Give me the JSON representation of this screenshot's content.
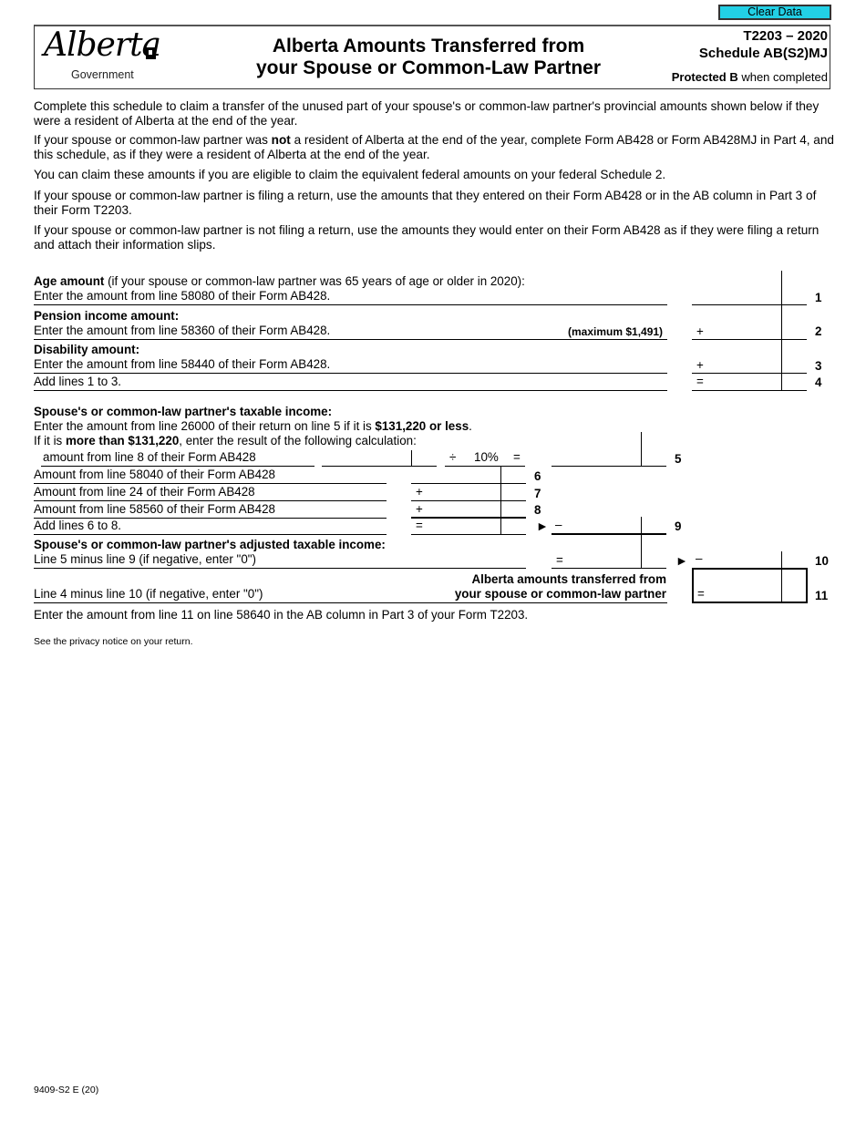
{
  "toolbar": {
    "clear_label": "Clear Data",
    "clear_color": "#22d0e6"
  },
  "header": {
    "logo_text": "Alberta",
    "logo_subtext": "Government",
    "title_line1": "Alberta Amounts Transferred from",
    "title_line2": "your Spouse or Common-Law Partner",
    "form_id": "T2203 – 2020",
    "schedule": "Schedule AB(S2)MJ",
    "protected_bold": "Protected B",
    "protected_rest": " when completed"
  },
  "intro": [
    {
      "parts": [
        {
          "t": "Complete this schedule to claim a transfer of the unused part of your spouse's or common-law partner's provincial amounts shown below if they were a resident of Alberta at the end of the year.",
          "b": false
        }
      ]
    },
    {
      "parts": [
        {
          "t": "If your spouse or common-law partner was ",
          "b": false
        },
        {
          "t": "not",
          "b": true
        },
        {
          "t": " a resident of Alberta at the end of the year, complete Form AB428 or Form AB428MJ in Part 4, and this schedule, as if they were a resident of Alberta at the end of the year.",
          "b": false
        }
      ]
    },
    {
      "parts": [
        {
          "t": "You can claim these amounts if you are eligible to claim the equivalent federal amounts on your federal Schedule 2.",
          "b": false
        }
      ]
    },
    {
      "parts": [
        {
          "t": "If your spouse or common-law partner is filing a return, use the amounts that they entered on their Form AB428 or in the AB column in Part 3 of their Form T2203.",
          "b": false
        }
      ]
    },
    {
      "parts": [
        {
          "t": "If your spouse or common-law partner is not filing a return, use the amounts they would enter on their Form AB428 as if they were filing a return and attach their information slips.",
          "b": false
        }
      ]
    }
  ],
  "lines": {
    "l1": {
      "heading": "Age amount",
      "heading_rest": " (if your spouse or common-law partner was 65 years of age or older in 2020):",
      "text": "Enter the amount from line 58080 of their Form AB428.",
      "num": "1",
      "op": "",
      "value": ""
    },
    "l2": {
      "heading": "Pension income amount:",
      "text": "Enter the amount from line 58360 of their Form AB428.",
      "note": "(maximum $1,491)",
      "num": "2",
      "op": "+",
      "value": ""
    },
    "l3": {
      "heading": "Disability amount:",
      "text": "Enter the amount from line 58440 of their Form AB428.",
      "num": "3",
      "op": "+",
      "value": ""
    },
    "l4": {
      "text": "Add lines 1 to 3.",
      "num": "4",
      "op": "=",
      "value": ""
    },
    "taxable": {
      "heading": "Spouse's or common-law partner's taxable income:",
      "text1_a": "Enter the amount from line 26000 of their return on line 5 if it is ",
      "text1_b": "$131,220 or less",
      "text1_c": ".",
      "text2_a": "If it is ",
      "text2_b": "more than $131,220",
      "text2_c": ", enter the result of the following calculation:"
    },
    "l5": {
      "text": "amount from line 8 of their Form AB428",
      "div_op": "÷",
      "pct": "10%",
      "eq": "=",
      "num": "5",
      "value": ""
    },
    "l6": {
      "text": "Amount from line 58040 of their Form AB428",
      "num": "6",
      "op": "",
      "value": ""
    },
    "l7": {
      "text": "Amount from line 24 of their Form AB428",
      "num": "7",
      "op": "+",
      "value": ""
    },
    "l8": {
      "text": "Amount from line 58560 of their Form AB428",
      "num": "8",
      "op": "+",
      "value": ""
    },
    "l9": {
      "text": "Add lines 6 to 8.",
      "num": "9",
      "op": "=",
      "arrow": "►",
      "minus": "–",
      "value": ""
    },
    "adjusted": {
      "heading": "Spouse's or common-law partner's adjusted taxable income:",
      "text": "Line 5 minus line 9 (if negative, enter \"0\")",
      "op": "=",
      "value": ""
    },
    "l10": {
      "num": "10",
      "arrow": "►",
      "minus": "–",
      "value": ""
    },
    "l11": {
      "text": "Line 4 minus line 10 (if negative, enter \"0\")",
      "label1": "Alberta amounts transferred from",
      "label2": "your spouse or common-law partner",
      "num": "11",
      "op": "=",
      "value": ""
    }
  },
  "footer": {
    "instruction": "Enter the amount from line 11 on line 58640 in the AB column in Part 3 of your Form T2203.",
    "privacy": "See the privacy notice on your return.",
    "form_code": "9409-S2 E (20)"
  }
}
